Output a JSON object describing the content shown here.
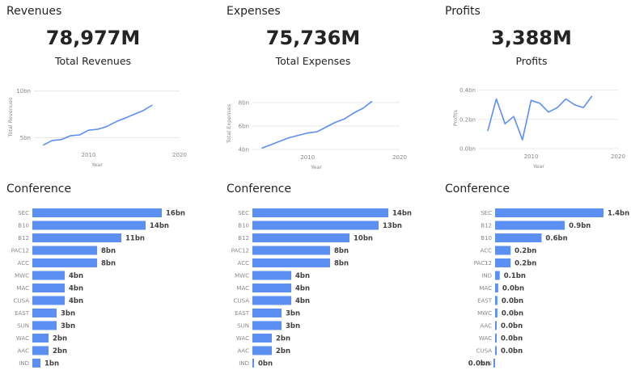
{
  "panels": [
    {
      "title": "Revenues",
      "kpi_value": "78,977M",
      "kpi_label": "Total Revenues",
      "bar_title": "Conference"
    },
    {
      "title": "Expenses",
      "kpi_value": "75,736M",
      "kpi_label": "Total Expenses",
      "bar_title": "Conference"
    },
    {
      "title": "Profits",
      "kpi_value": "3,388M",
      "kpi_label": "Profits",
      "bar_title": "Conference"
    }
  ],
  "colors": {
    "series": "#5b8ff2",
    "axis_text": "#8a8886",
    "label_text": "#404040"
  },
  "chart_data": [
    {
      "type": "line",
      "title": "",
      "xlabel": "Year",
      "ylabel": "Total Revenues",
      "x": [
        2005,
        2006,
        2007,
        2008,
        2009,
        2010,
        2011,
        2012,
        2013,
        2014,
        2015,
        2016,
        2017
      ],
      "y": [
        4.2,
        4.7,
        4.8,
        5.2,
        5.3,
        5.8,
        5.9,
        6.2,
        6.7,
        7.1,
        7.5,
        7.9,
        8.5
      ],
      "xlim": [
        2004,
        2020
      ],
      "ylim": [
        4,
        10.4
      ],
      "xticks": [
        2010,
        2020
      ],
      "xtick_labels": [
        "2010",
        "2020"
      ],
      "yticks": [
        5,
        10
      ],
      "ytick_labels": [
        "5bn",
        "10bn"
      ]
    },
    {
      "type": "line",
      "title": "",
      "xlabel": "Year",
      "ylabel": "Total Expenses",
      "x": [
        2005,
        2006,
        2007,
        2008,
        2009,
        2010,
        2011,
        2012,
        2013,
        2014,
        2015,
        2016,
        2017
      ],
      "y": [
        4.1,
        4.4,
        4.7,
        5.0,
        5.2,
        5.4,
        5.5,
        5.9,
        6.3,
        6.6,
        7.1,
        7.5,
        8.1
      ],
      "xlim": [
        2004,
        2020
      ],
      "ylim": [
        4,
        8.4
      ],
      "xticks": [
        2010,
        2020
      ],
      "xtick_labels": [
        "2010",
        "2020"
      ],
      "yticks": [
        4,
        6,
        8
      ],
      "ytick_labels": [
        "4bn",
        "6bn",
        "8bn"
      ]
    },
    {
      "type": "line",
      "title": "",
      "xlabel": "Year",
      "ylabel": "Profits",
      "x": [
        2005,
        2006,
        2007,
        2008,
        2009,
        2010,
        2011,
        2012,
        2013,
        2014,
        2015,
        2016,
        2017
      ],
      "y": [
        0.12,
        0.34,
        0.17,
        0.22,
        0.06,
        0.33,
        0.31,
        0.25,
        0.28,
        0.34,
        0.3,
        0.28,
        0.36
      ],
      "xlim": [
        2004,
        2020
      ],
      "ylim": [
        0,
        0.42
      ],
      "xticks": [
        2010,
        2020
      ],
      "xtick_labels": [
        "2010",
        "2020"
      ],
      "yticks": [
        0,
        0.2,
        0.4
      ],
      "ytick_labels": [
        "0.0bn",
        "0.2bn",
        "0.4bn"
      ]
    },
    {
      "type": "bar",
      "orientation": "horizontal",
      "title": "Conference",
      "categories": [
        "SEC",
        "B10",
        "B12",
        "PAC12",
        "ACC",
        "MWC",
        "MAC",
        "CUSA",
        "EAST",
        "SUN",
        "WAC",
        "AAC",
        "IND"
      ],
      "values": [
        16,
        14,
        11,
        8,
        8,
        4,
        4,
        4,
        3,
        3,
        2,
        2,
        1
      ],
      "labels": [
        "16bn",
        "14bn",
        "11bn",
        "8bn",
        "8bn",
        "4bn",
        "4bn",
        "4bn",
        "3bn",
        "3bn",
        "2bn",
        "2bn",
        "1bn"
      ]
    },
    {
      "type": "bar",
      "orientation": "horizontal",
      "title": "Conference",
      "categories": [
        "SEC",
        "B10",
        "B12",
        "PAC12",
        "ACC",
        "MWC",
        "MAC",
        "CUSA",
        "EAST",
        "SUN",
        "WAC",
        "AAC",
        "IND"
      ],
      "values": [
        14,
        13,
        10,
        8,
        8,
        4,
        4,
        4,
        3,
        3,
        2,
        2,
        0.1
      ],
      "labels": [
        "14bn",
        "13bn",
        "10bn",
        "8bn",
        "8bn",
        "4bn",
        "4bn",
        "4bn",
        "3bn",
        "3bn",
        "2bn",
        "2bn",
        "0bn"
      ]
    },
    {
      "type": "bar",
      "orientation": "horizontal",
      "title": "Conference",
      "categories": [
        "SEC",
        "B12",
        "B10",
        "ACC",
        "PAC12",
        "IND",
        "MAC",
        "EAST",
        "MWC",
        "AAC",
        "WAC",
        "CUSA",
        "SUN"
      ],
      "values": [
        1.4,
        0.9,
        0.6,
        0.2,
        0.2,
        0.06,
        0.04,
        0.03,
        0.03,
        0.02,
        0.02,
        0.01,
        -0.02
      ],
      "labels": [
        "1.4bn",
        "0.9bn",
        "0.6bn",
        "0.2bn",
        "0.2bn",
        "0.1bn",
        "0.0bn",
        "0.0bn",
        "0.0bn",
        "0.0bn",
        "0.0bn",
        "0.0bn",
        "0.0bn"
      ]
    }
  ]
}
